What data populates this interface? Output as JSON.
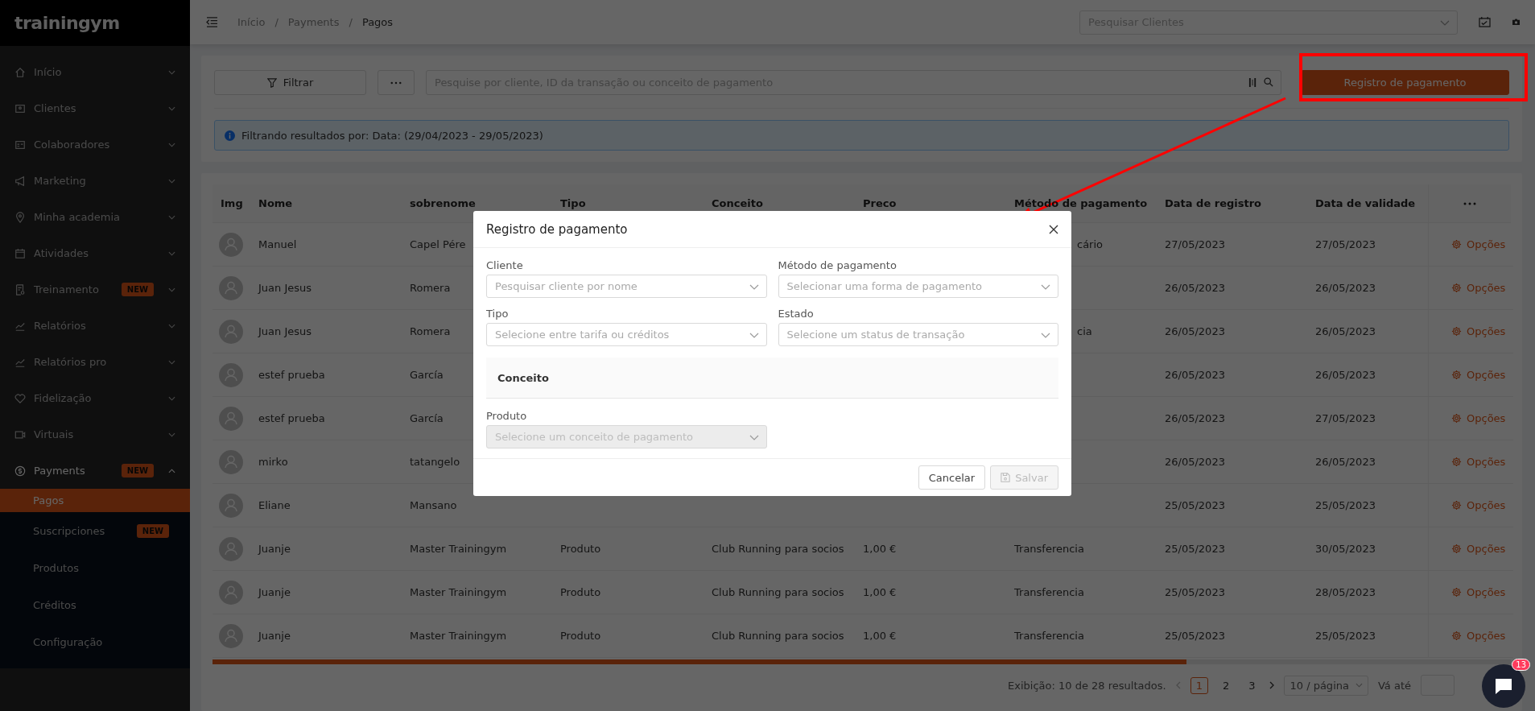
{
  "sidebar": {
    "logo": "trainingym",
    "items": [
      {
        "label": "Início",
        "expanded": false
      },
      {
        "label": "Clientes",
        "expanded": false
      },
      {
        "label": "Colaboradores",
        "expanded": false
      },
      {
        "label": "Marketing",
        "expanded": false
      },
      {
        "label": "Minha academia",
        "expanded": false
      },
      {
        "label": "Atividades",
        "expanded": false
      },
      {
        "label": "Treinamento",
        "badge": "NEW",
        "expanded": false
      },
      {
        "label": "Relatórios",
        "expanded": false
      },
      {
        "label": "Relatórios pro",
        "expanded": false
      },
      {
        "label": "Fidelização",
        "expanded": false
      },
      {
        "label": "Virtuais",
        "expanded": false
      },
      {
        "label": "Payments",
        "badge": "NEW",
        "expanded": true,
        "children": [
          {
            "label": "Pagos",
            "selected": true
          },
          {
            "label": "Suscripciones",
            "badge": "NEW",
            "selected": false
          },
          {
            "label": "Produtos",
            "selected": false
          },
          {
            "label": "Créditos",
            "selected": false
          },
          {
            "label": "Configuração",
            "selected": false
          }
        ]
      }
    ]
  },
  "topbar": {
    "breadcrumbs": [
      {
        "label": "Início"
      },
      {
        "separator": "/",
        "label": "Payments"
      },
      {
        "separator": "/",
        "label": "Pagos"
      }
    ],
    "client_search": {
      "placeholder": "Pesquisar Clientes"
    }
  },
  "toolbar": {
    "filter_button": "Filtrar",
    "search": {
      "placeholder": "Pesquise por cliente, ID da transação ou conceito de pagamento"
    },
    "register_button": "Registro de pagamento",
    "info": "Filtrando resultados por: Data: (29/04/2023 - 29/05/2023)"
  },
  "table": {
    "columns": [
      "Img",
      "Nome",
      "sobrenome",
      "Tipo",
      "Conceito",
      "Preco",
      "Método de pagamento",
      "Data de registro",
      "Data de validade"
    ],
    "rows": [
      {
        "name": "Manuel",
        "surname": "Capel Pére",
        "method": {
          "text": "cário",
          "covered": true
        },
        "registered": "27/05/2023",
        "valid_until": "27/05/2023",
        "action": "Opções"
      },
      {
        "name": "Juan Jesus",
        "surname": "Romera",
        "registered": "26/05/2023",
        "valid_until": "26/05/2023",
        "action": "Opções"
      },
      {
        "name": "Juan Jesus",
        "surname": "Romera",
        "method": {
          "text": "cia",
          "covered": true
        },
        "registered": "26/05/2023",
        "valid_until": "26/05/2023",
        "action": "Opções"
      },
      {
        "name": "estef prueba",
        "surname": "García",
        "registered": "26/05/2023",
        "valid_until": "26/05/2023",
        "action": "Opções"
      },
      {
        "name": "estef prueba",
        "surname": "García",
        "registered": "26/05/2023",
        "valid_until": "27/05/2023",
        "action": "Opções"
      },
      {
        "name": "mirko",
        "surname": "tatangelo",
        "registered": "26/05/2023",
        "valid_until": "26/05/2023",
        "action": "Opções"
      },
      {
        "name": "Eliane",
        "surname": "Mansano",
        "registered": "25/05/2023",
        "valid_until": "25/05/2023",
        "action": "Opções"
      },
      {
        "name": "Juanje",
        "surname": "Master Trainingym",
        "type": "Produto",
        "concept": "Club Running para socios",
        "price": "1,00 €",
        "method": {
          "text": "Transferencia",
          "covered": false
        },
        "registered": "25/05/2023",
        "valid_until": "30/05/2023",
        "action": "Opções"
      },
      {
        "name": "Juanje",
        "surname": "Master Trainingym",
        "type": "Produto",
        "concept": "Club Running para socios",
        "price": "1,00 €",
        "method": {
          "text": "Transferencia",
          "covered": false
        },
        "registered": "25/05/2023",
        "valid_until": "28/05/2023",
        "action": "Opções"
      },
      {
        "name": "Juanje",
        "surname": "Master Trainingym",
        "type": "Produto",
        "concept": "Club Running para socios",
        "price": "1,00 €",
        "method": {
          "text": "Transferencia",
          "covered": false
        },
        "registered": "25/05/2023",
        "valid_until": "25/05/2023",
        "action": "Opções"
      }
    ]
  },
  "pagination": {
    "summary": "Exibição: 10 de 28 resultados.",
    "pages": [
      {
        "label": "1",
        "selected": true
      },
      {
        "label": "2",
        "selected": false
      },
      {
        "label": "3",
        "selected": false
      }
    ],
    "page_size": "10 / página",
    "goto_label": "Vá até"
  },
  "chat": {
    "badge": "13"
  },
  "modal": {
    "title": "Registro de pagamento",
    "fields": [
      {
        "label": "Cliente",
        "placeholder": "Pesquisar cliente por nome",
        "disabled": false
      },
      {
        "label": "Método de pagamento",
        "placeholder": "Selecionar uma forma de pagamento",
        "disabled": false
      },
      {
        "label": "Tipo",
        "placeholder": "Selecione entre tarifa ou créditos",
        "disabled": false
      },
      {
        "label": "Estado",
        "placeholder": "Selecione um status de transação",
        "disabled": false
      }
    ],
    "section": "Conceito",
    "product_field": {
      "label": "Produto",
      "placeholder": "Selecione um conceito de pagamento",
      "disabled": true
    },
    "buttons": [
      {
        "label": "Cancelar",
        "kind": "secondary",
        "disabled": false
      },
      {
        "label": "Salvar",
        "kind": "save",
        "disabled": true
      }
    ]
  }
}
